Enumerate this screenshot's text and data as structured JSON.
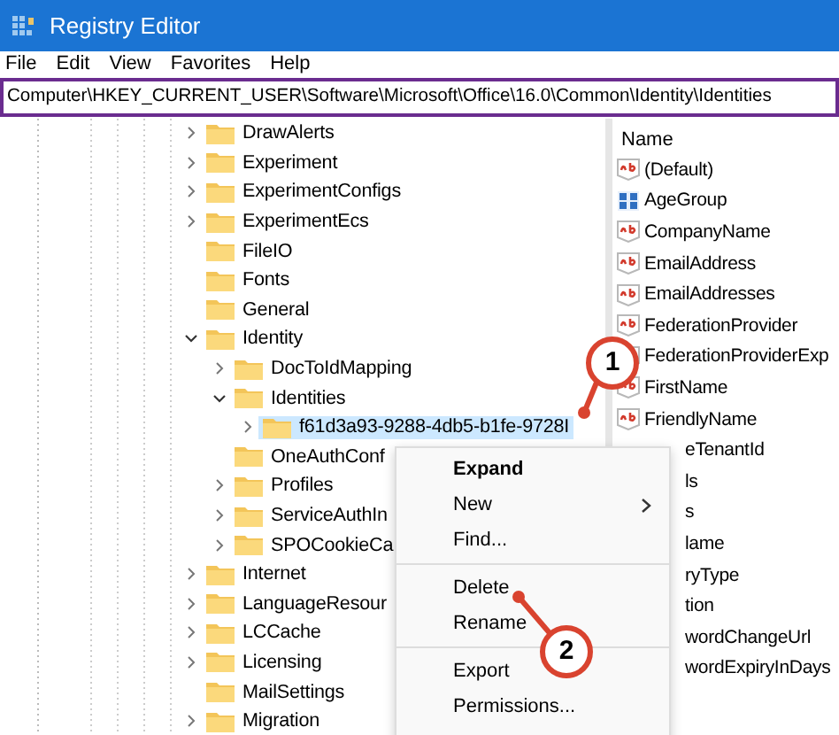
{
  "window": {
    "title": "Registry Editor"
  },
  "menu_bar": [
    "File",
    "Edit",
    "View",
    "Favorites",
    "Help"
  ],
  "address_bar": {
    "value": "Computer\\HKEY_CURRENT_USER\\Software\\Microsoft\\Office\\16.0\\Common\\Identity\\Identities",
    "highlighted": true
  },
  "tree": [
    {
      "label": "DrawAlerts",
      "expanded": false,
      "selected": false
    },
    {
      "label": "Experiment",
      "expanded": false,
      "selected": false
    },
    {
      "label": "ExperimentConfigs",
      "expanded": false,
      "selected": false
    },
    {
      "label": "ExperimentEcs",
      "expanded": false,
      "selected": false
    },
    {
      "label": "FileIO",
      "selected": false
    },
    {
      "label": "Fonts",
      "selected": false
    },
    {
      "label": "General",
      "selected": false
    },
    {
      "label": "Identity",
      "expanded": true,
      "selected": false,
      "children": [
        {
          "label": "DocToIdMapping",
          "expanded": false,
          "selected": false
        },
        {
          "label": "Identities",
          "expanded": true,
          "selected": false,
          "children": [
            {
              "label": "f61d3a93-9288-4db5-b1fe-9728I",
              "expanded": false,
              "selected": true
            }
          ]
        },
        {
          "label": "OneAuthConf",
          "selected": false
        },
        {
          "label": "Profiles",
          "expanded": false,
          "selected": false
        },
        {
          "label": "ServiceAuthIn",
          "expanded": false,
          "selected": false
        },
        {
          "label": "SPOCookieCa",
          "expanded": false,
          "selected": false
        }
      ]
    },
    {
      "label": "Internet",
      "expanded": false,
      "selected": false
    },
    {
      "label": "LanguageResour",
      "expanded": false,
      "selected": false
    },
    {
      "label": "LCCache",
      "expanded": false,
      "selected": false
    },
    {
      "label": "Licensing",
      "expanded": false,
      "selected": false
    },
    {
      "label": "MailSettings",
      "selected": false
    },
    {
      "label": "Migration",
      "expanded": false,
      "selected": false
    }
  ],
  "values": {
    "column": "Name",
    "rows": [
      {
        "name": "(Default)",
        "kind": "string"
      },
      {
        "name": "AgeGroup",
        "kind": "binary"
      },
      {
        "name": "CompanyName",
        "kind": "string"
      },
      {
        "name": "EmailAddress",
        "kind": "string"
      },
      {
        "name": "EmailAddresses",
        "kind": "string"
      },
      {
        "name": "FederationProvider",
        "kind": "string"
      },
      {
        "name": "FederationProviderExp",
        "kind": "string"
      },
      {
        "name": "FirstName",
        "kind": "string"
      },
      {
        "name": "FriendlyName",
        "kind": "string"
      },
      {
        "name": "eTenantId",
        "kind": "covered"
      },
      {
        "name": "ls",
        "kind": "covered"
      },
      {
        "name": "s",
        "kind": "covered"
      },
      {
        "name": "lame",
        "kind": "covered"
      },
      {
        "name": "ryType",
        "kind": "covered"
      },
      {
        "name": "tion",
        "kind": "covered"
      },
      {
        "name": "wordChangeUrl",
        "kind": "covered"
      },
      {
        "name": "wordExpiryInDays",
        "kind": "covered"
      }
    ]
  },
  "context_menu": [
    {
      "label": "Expand",
      "kind": "default"
    },
    {
      "label": "New",
      "kind": "submenu"
    },
    {
      "label": "Find...",
      "kind": "item"
    },
    {
      "kind": "separator"
    },
    {
      "label": "Delete",
      "kind": "item"
    },
    {
      "label": "Rename",
      "kind": "item"
    },
    {
      "kind": "separator"
    },
    {
      "label": "Export",
      "kind": "item"
    },
    {
      "label": "Permissions...",
      "kind": "item"
    }
  ],
  "annotations": [
    {
      "number": "1"
    },
    {
      "number": "2"
    }
  ]
}
